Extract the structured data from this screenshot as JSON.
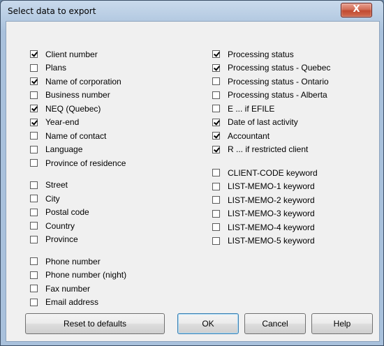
{
  "dialog": {
    "title": "Select data to export",
    "close_label": "X"
  },
  "left_groups": [
    [
      {
        "label": "Client number",
        "checked": true
      },
      {
        "label": "Plans",
        "checked": false
      },
      {
        "label": "Name of corporation",
        "checked": true
      },
      {
        "label": "Business number",
        "checked": false
      },
      {
        "label": "NEQ (Quebec)",
        "checked": true
      },
      {
        "label": "Year-end",
        "checked": true
      },
      {
        "label": "Name of contact",
        "checked": false
      },
      {
        "label": "Language",
        "checked": false
      },
      {
        "label": "Province of residence",
        "checked": false
      }
    ],
    [
      {
        "label": "Street",
        "checked": false
      },
      {
        "label": "City",
        "checked": false
      },
      {
        "label": "Postal code",
        "checked": false
      },
      {
        "label": "Country",
        "checked": false
      },
      {
        "label": "Province",
        "checked": false
      }
    ],
    [
      {
        "label": "Phone number",
        "checked": false
      },
      {
        "label": "Phone number (night)",
        "checked": false
      },
      {
        "label": "Fax number",
        "checked": false
      },
      {
        "label": "Email address",
        "checked": false
      }
    ]
  ],
  "right_groups": [
    [
      {
        "label": "Processing status",
        "checked": true
      },
      {
        "label": "Processing status - Quebec",
        "checked": true
      },
      {
        "label": "Processing status - Ontario",
        "checked": false
      },
      {
        "label": "Processing status - Alberta",
        "checked": false
      },
      {
        "label": "E ... if EFILE",
        "checked": false
      },
      {
        "label": "Date of last activity",
        "checked": true
      },
      {
        "label": "Accountant",
        "checked": true
      },
      {
        "label": "R ... if restricted client",
        "checked": true
      }
    ],
    [
      {
        "label": "CLIENT-CODE keyword",
        "checked": false
      },
      {
        "label": "LIST-MEMO-1 keyword",
        "checked": false
      },
      {
        "label": "LIST-MEMO-2 keyword",
        "checked": false
      },
      {
        "label": "LIST-MEMO-3 keyword",
        "checked": false
      },
      {
        "label": "LIST-MEMO-4 keyword",
        "checked": false
      },
      {
        "label": "LIST-MEMO-5 keyword",
        "checked": false
      }
    ]
  ],
  "buttons": {
    "reset": "Reset to defaults",
    "ok": "OK",
    "cancel": "Cancel",
    "help": "Help"
  }
}
